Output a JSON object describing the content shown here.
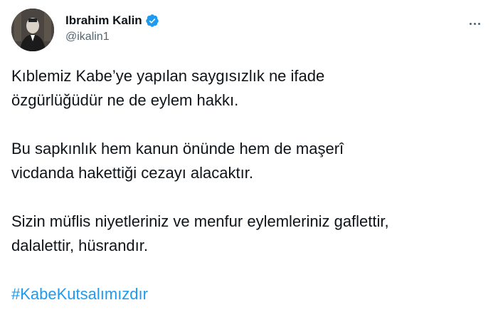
{
  "author": {
    "display_name": "Ibrahim Kalin",
    "handle": "@ikalin1",
    "verified_icon": "verified-badge-icon",
    "avatar_icon": "profile-avatar"
  },
  "more_icon": "more-horizontal-icon",
  "tweet": {
    "paragraphs": [
      [
        "Kıblemiz Kabe’ye yapılan saygısızlık ne ifade",
        "özgürlüğüdür ne de eylem hakkı."
      ],
      [
        "Bu sapkınlık hem kanun önünde hem de maşerî",
        "vicdanda hakettiği cezayı alacaktır."
      ],
      [
        "Sizin müflis niyetleriniz ve menfur eylemleriniz gaflettir,",
        "dalalettir, hüsrandır."
      ]
    ],
    "hashtag": "#KabeKutsalımızdır"
  },
  "colors": {
    "text": "#0f1419",
    "secondary": "#536471",
    "accent": "#1d9bf0"
  }
}
